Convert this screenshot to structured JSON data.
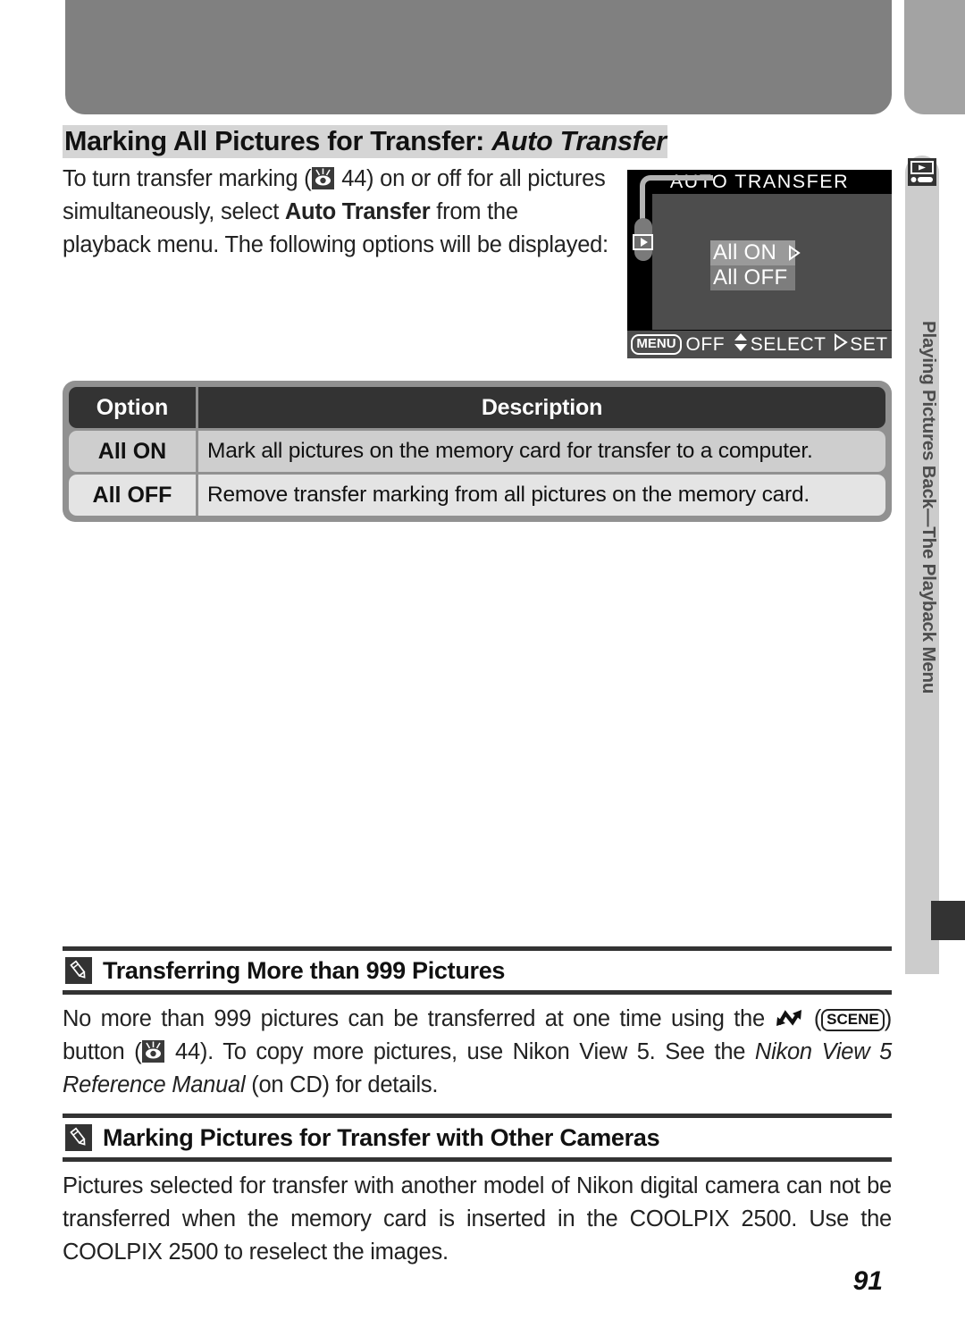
{
  "header": {
    "band_color": "#808080",
    "band_right_color": "#a3a3a3"
  },
  "side_tab": {
    "icon": "playback-icon",
    "label": "Playing Pictures Back—The Playback Menu",
    "background": "#cccccc",
    "marker_color": "#333333"
  },
  "title": {
    "main": "Marking All Pictures for Transfer:",
    "emphasis": "Auto Transfer"
  },
  "intro": {
    "part1": "To turn transfer marking (",
    "icon1": "eye-reference-icon",
    "part2": " 44) on or off for all pictures simultaneously, select ",
    "bold": "Auto Transfer",
    "part3": " from the playback menu.  The following options will be displayed:"
  },
  "lcd": {
    "title": "AUTO  TRANSFER",
    "options": [
      {
        "label": "All ON",
        "selected": true,
        "arrow": true
      },
      {
        "label": "All OFF",
        "selected": false,
        "arrow": false
      }
    ],
    "bottom": {
      "menu_badge": "MENU",
      "menu_label": "OFF",
      "select_label": "SELECT",
      "set_label": "SET"
    }
  },
  "table": {
    "headers": {
      "option": "Option",
      "description": "Description"
    },
    "rows": [
      {
        "option": "All ON",
        "description": "Mark all pictures on the memory card for transfer to a computer."
      },
      {
        "option": "All OFF",
        "description": "Remove transfer marking from all pictures on the memory card."
      }
    ]
  },
  "notes": [
    {
      "icon": "pencil-note-icon",
      "heading": "Transferring More than 999 Pictures",
      "body_part1": "No more than 999 pictures can be transferred at one time using the ",
      "body_icon1": "transfer-arrow-icon",
      "body_part2": " (",
      "body_badge": "SCENE",
      "body_part3": ") button (",
      "body_icon2": "eye-reference-icon",
      "body_part4": " 44).  To copy more pictures, use Nikon View 5.  See the ",
      "body_italic": "Nikon View 5 Reference Manual",
      "body_part5": " (on CD) for details."
    },
    {
      "icon": "pencil-note-icon",
      "heading": "Marking Pictures for Transfer with Other Cameras",
      "body": "Pictures selected for transfer with another model of Nikon digital camera can not be transferred when the memory card is inserted in the COOLPIX 2500.  Use the COOLPIX 2500 to reselect the images."
    }
  ],
  "page_number": "91"
}
